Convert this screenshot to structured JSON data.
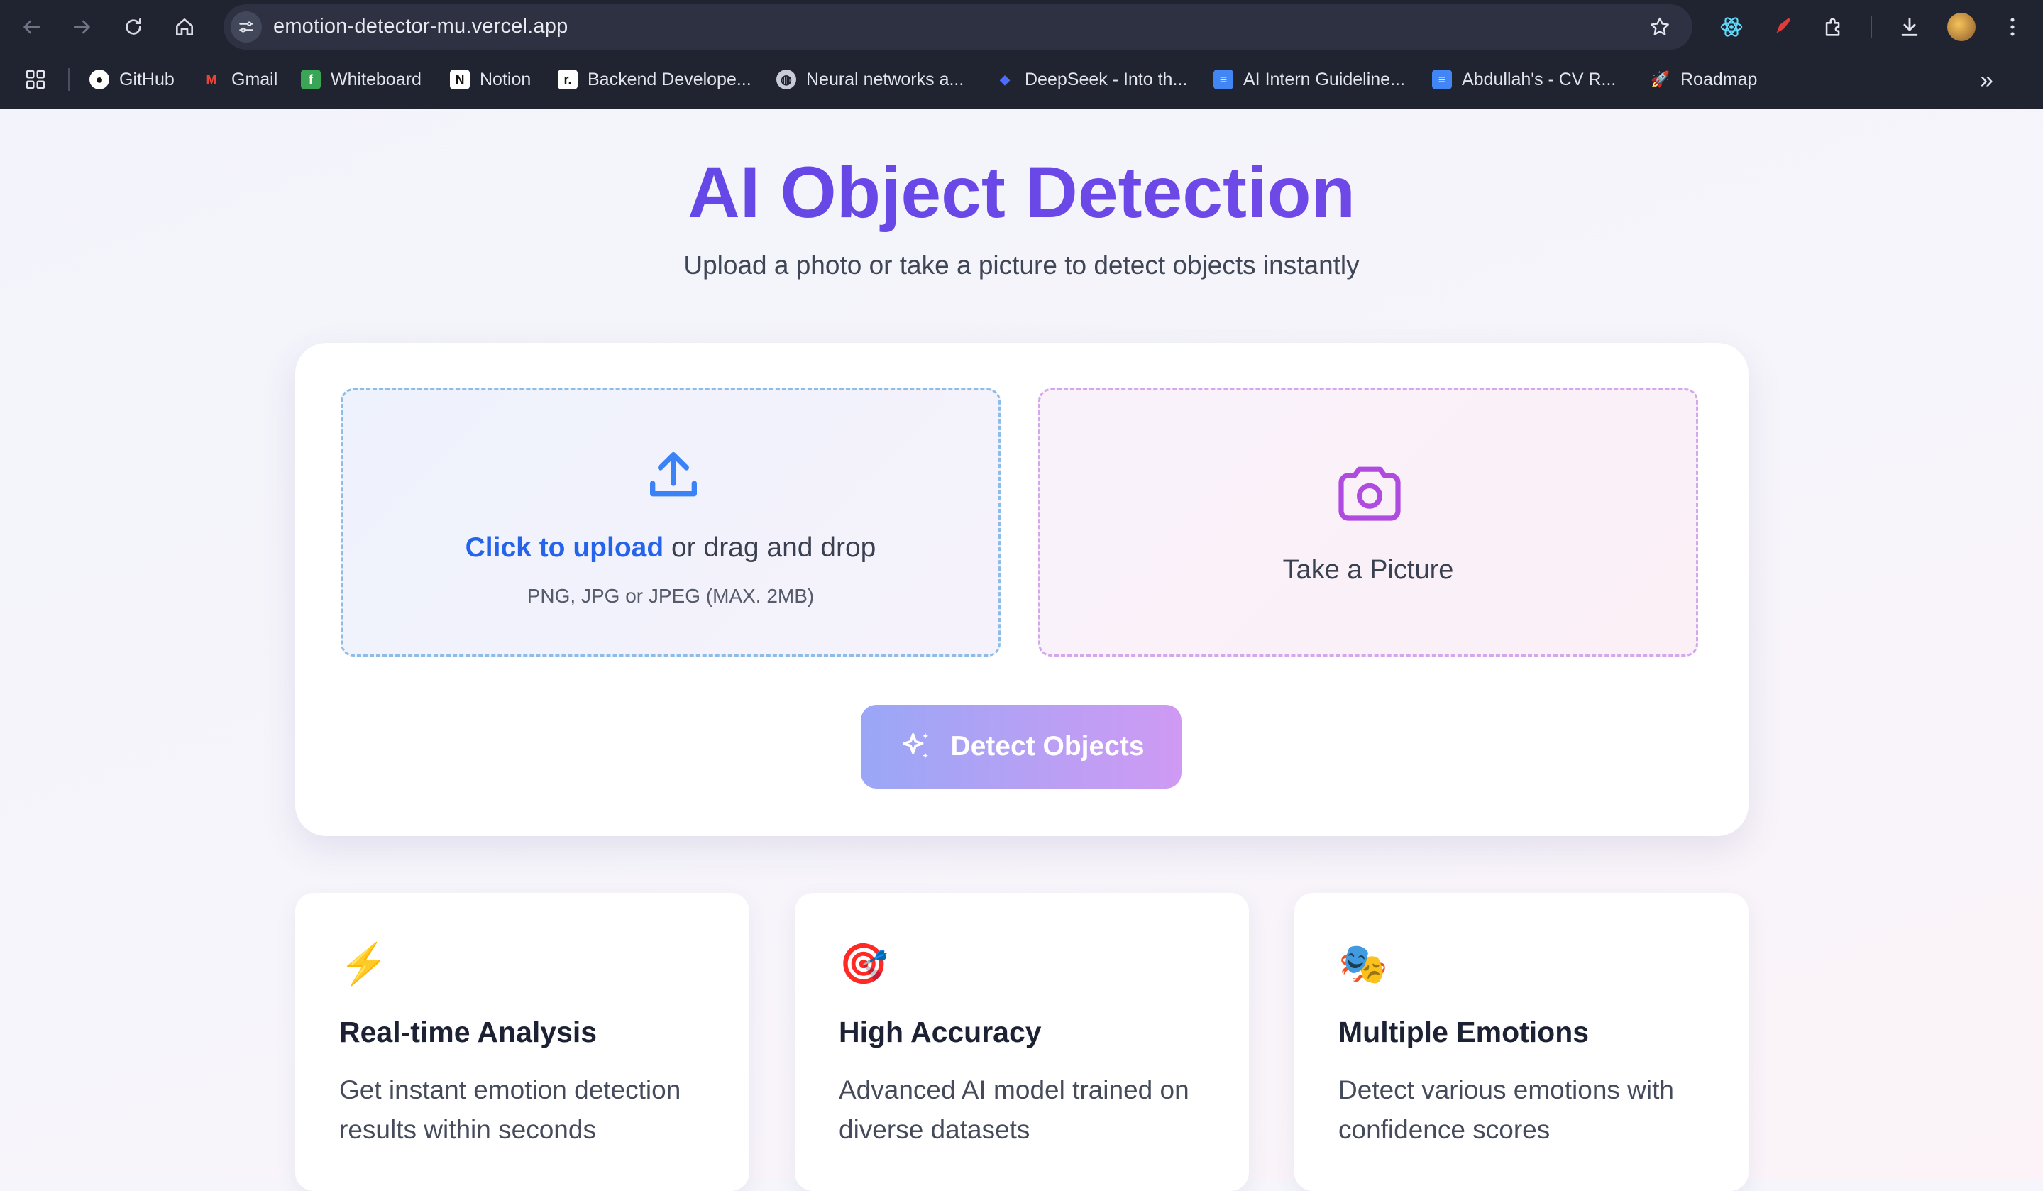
{
  "browser": {
    "url": "emotion-detector-mu.vercel.app",
    "bookmarks": [
      {
        "label": "GitHub",
        "icon": "github-icon"
      },
      {
        "label": "Gmail",
        "icon": "gmail-icon"
      },
      {
        "label": "Whiteboard",
        "icon": "whiteboard-icon"
      },
      {
        "label": "Notion",
        "icon": "notion-icon"
      },
      {
        "label": "Backend Develope...",
        "icon": "roadmap-sh-icon"
      },
      {
        "label": "Neural networks a...",
        "icon": "globe-icon"
      },
      {
        "label": "DeepSeek - Into th...",
        "icon": "deepseek-icon"
      },
      {
        "label": "AI Intern Guideline...",
        "icon": "google-docs-icon"
      },
      {
        "label": "Abdullah's - CV R...",
        "icon": "google-docs-icon"
      },
      {
        "label": "Roadmap",
        "icon": "rocket-icon"
      }
    ]
  },
  "header": {
    "title": "AI Object Detection",
    "subtitle": "Upload a photo or take a picture to detect objects instantly"
  },
  "upload": {
    "link_text": "Click to upload",
    "rest_text": " or drag and drop",
    "hint": "PNG, JPG or JPEG (MAX. 2MB)"
  },
  "camera": {
    "label": "Take a Picture"
  },
  "detect_button": {
    "label": "Detect Objects"
  },
  "features": [
    {
      "emoji": "⚡",
      "title": "Real-time Analysis",
      "description": "Get instant emotion detection results within seconds"
    },
    {
      "emoji": "🎯",
      "title": "High Accuracy",
      "description": "Advanced AI model trained on diverse datasets"
    },
    {
      "emoji": "🎭",
      "title": "Multiple Emotions",
      "description": "Detect various emotions with confidence scores"
    }
  ],
  "colors": {
    "title_gradient_start": "#5a47e8",
    "link_blue": "#2563eb",
    "camera_purple": "#b04be0",
    "button_gradient": [
      "#9aa7f6",
      "#cf9af3"
    ]
  }
}
